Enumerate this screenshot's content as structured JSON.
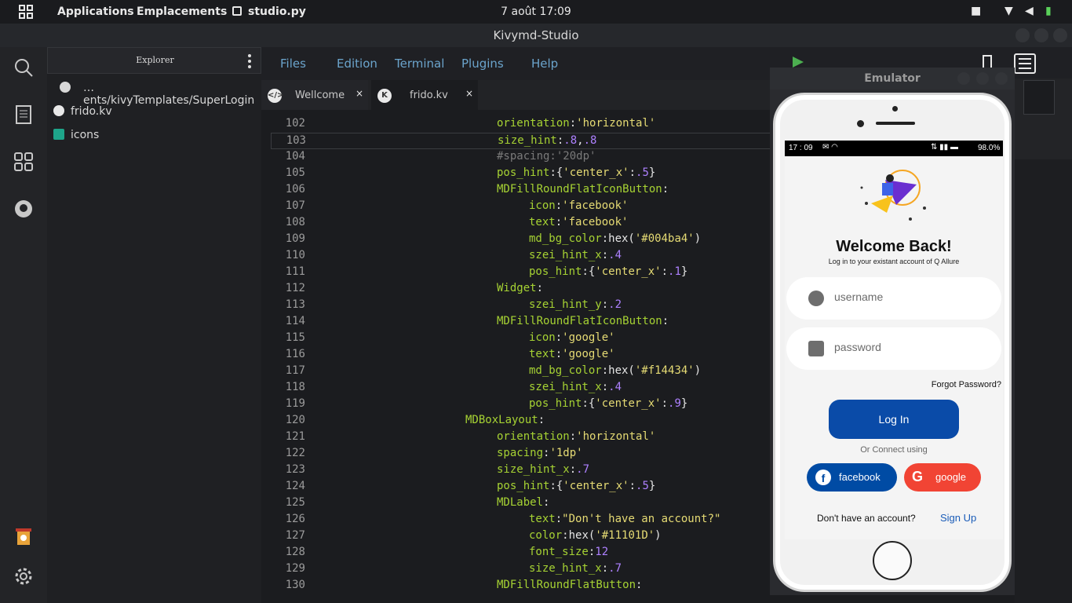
{
  "topbar": {
    "applications": "Applications",
    "emplacements": "Emplacements",
    "active_app": "studio.py",
    "clock": "7 août  17:09"
  },
  "window": {
    "title": "Kivymd-Studio"
  },
  "explorer": {
    "header": "Explorer",
    "path": "…ents/kivyTemplates/SuperLogin",
    "items": [
      {
        "label": "frido.kv",
        "icon": "kivy-file-icon"
      },
      {
        "label": "icons",
        "icon": "folder-icon"
      }
    ]
  },
  "menu": [
    "Files",
    "Edition",
    "Terminal",
    "Plugins",
    "Help"
  ],
  "tabs": [
    {
      "label": "Wellcome",
      "close": "×"
    },
    {
      "label": "frido.kv",
      "close": "×"
    }
  ],
  "code": [
    {
      "n": "102",
      "indent": 300,
      "parts": [
        [
          "k",
          "orientation"
        ],
        [
          "p",
          ":"
        ],
        [
          "s",
          "'horizontal'"
        ]
      ]
    },
    {
      "n": "103",
      "indent": 300,
      "active": true,
      "parts": [
        [
          "k",
          "size_hint"
        ],
        [
          "p",
          ":"
        ],
        [
          "n",
          ".8"
        ],
        [
          "p",
          ","
        ],
        [
          "n",
          ".8"
        ]
      ]
    },
    {
      "n": "104",
      "indent": 300,
      "parts": [
        [
          "c",
          "#spacing:'20dp'"
        ]
      ]
    },
    {
      "n": "105",
      "indent": 300,
      "parts": [
        [
          "k",
          "pos_hint"
        ],
        [
          "p",
          ":{"
        ],
        [
          "s",
          "'center_x'"
        ],
        [
          "p",
          ":"
        ],
        [
          "n",
          ".5"
        ],
        [
          "p",
          "}"
        ]
      ]
    },
    {
      "n": "106",
      "indent": 300,
      "parts": [
        [
          "k",
          "MDFillRoundFlatIconButton"
        ],
        [
          "p",
          ":"
        ]
      ]
    },
    {
      "n": "107",
      "indent": 341,
      "parts": [
        [
          "k",
          "icon"
        ],
        [
          "p",
          ":"
        ],
        [
          "s",
          "'facebook'"
        ]
      ]
    },
    {
      "n": "108",
      "indent": 341,
      "parts": [
        [
          "k",
          "text"
        ],
        [
          "p",
          ":"
        ],
        [
          "s",
          "'facebook'"
        ]
      ]
    },
    {
      "n": "109",
      "indent": 341,
      "parts": [
        [
          "k",
          "md_bg_color"
        ],
        [
          "p",
          ":hex("
        ],
        [
          "s",
          "'#004ba4'"
        ],
        [
          "p",
          ")"
        ]
      ]
    },
    {
      "n": "110",
      "indent": 341,
      "parts": [
        [
          "k",
          "szei_hint_x"
        ],
        [
          "p",
          ":"
        ],
        [
          "n",
          ".4"
        ]
      ]
    },
    {
      "n": "111",
      "indent": 341,
      "parts": [
        [
          "k",
          "pos_hint"
        ],
        [
          "p",
          ":{"
        ],
        [
          "s",
          "'center_x'"
        ],
        [
          "p",
          ":"
        ],
        [
          "n",
          ".1"
        ],
        [
          "p",
          "}"
        ]
      ]
    },
    {
      "n": "112",
      "indent": 300,
      "parts": [
        [
          "k",
          "Widget"
        ],
        [
          "p",
          ":"
        ]
      ]
    },
    {
      "n": "113",
      "indent": 341,
      "parts": [
        [
          "k",
          "szei_hint_y"
        ],
        [
          "p",
          ":"
        ],
        [
          "n",
          ".2"
        ]
      ]
    },
    {
      "n": "114",
      "indent": 300,
      "parts": [
        [
          "k",
          "MDFillRoundFlatIconButton"
        ],
        [
          "p",
          ":"
        ]
      ]
    },
    {
      "n": "115",
      "indent": 341,
      "parts": [
        [
          "k",
          "icon"
        ],
        [
          "p",
          ":"
        ],
        [
          "s",
          "'google'"
        ]
      ]
    },
    {
      "n": "116",
      "indent": 341,
      "parts": [
        [
          "k",
          "text"
        ],
        [
          "p",
          ":"
        ],
        [
          "s",
          "'google'"
        ]
      ]
    },
    {
      "n": "117",
      "indent": 341,
      "parts": [
        [
          "k",
          "md_bg_color"
        ],
        [
          "p",
          ":hex("
        ],
        [
          "s",
          "'#f14434'"
        ],
        [
          "p",
          ")"
        ]
      ]
    },
    {
      "n": "118",
      "indent": 341,
      "parts": [
        [
          "k",
          "szei_hint_x"
        ],
        [
          "p",
          ":"
        ],
        [
          "n",
          ".4"
        ]
      ]
    },
    {
      "n": "119",
      "indent": 341,
      "parts": [
        [
          "k",
          "pos_hint"
        ],
        [
          "p",
          ":{"
        ],
        [
          "s",
          "'center_x'"
        ],
        [
          "p",
          ":"
        ],
        [
          "n",
          ".9"
        ],
        [
          "p",
          "}"
        ]
      ]
    },
    {
      "n": "120",
      "indent": 260,
      "parts": [
        [
          "k",
          "MDBoxLayout"
        ],
        [
          "p",
          ":"
        ]
      ]
    },
    {
      "n": "121",
      "indent": 300,
      "parts": [
        [
          "k",
          "orientation"
        ],
        [
          "p",
          ":"
        ],
        [
          "s",
          "'horizontal'"
        ]
      ]
    },
    {
      "n": "122",
      "indent": 300,
      "parts": [
        [
          "k",
          "spacing"
        ],
        [
          "p",
          ":"
        ],
        [
          "s",
          "'1dp'"
        ]
      ]
    },
    {
      "n": "123",
      "indent": 300,
      "parts": [
        [
          "k",
          "size_hint_x"
        ],
        [
          "p",
          ":"
        ],
        [
          "n",
          ".7"
        ]
      ]
    },
    {
      "n": "124",
      "indent": 300,
      "parts": [
        [
          "k",
          "pos_hint"
        ],
        [
          "p",
          ":{"
        ],
        [
          "s",
          "'center_x'"
        ],
        [
          "p",
          ":"
        ],
        [
          "n",
          ".5"
        ],
        [
          "p",
          "}"
        ]
      ]
    },
    {
      "n": "125",
      "indent": 300,
      "parts": [
        [
          "k",
          "MDLabel"
        ],
        [
          "p",
          ":"
        ]
      ]
    },
    {
      "n": "126",
      "indent": 341,
      "parts": [
        [
          "k",
          "text"
        ],
        [
          "p",
          ":"
        ],
        [
          "s",
          "\"Don't have an account?\""
        ]
      ]
    },
    {
      "n": "127",
      "indent": 341,
      "parts": [
        [
          "k",
          "color"
        ],
        [
          "p",
          ":hex("
        ],
        [
          "s",
          "'#11101D'"
        ],
        [
          "p",
          ")"
        ]
      ]
    },
    {
      "n": "128",
      "indent": 341,
      "parts": [
        [
          "k",
          "font_size"
        ],
        [
          "p",
          ":"
        ],
        [
          "n",
          "12"
        ]
      ]
    },
    {
      "n": "129",
      "indent": 341,
      "parts": [
        [
          "k",
          "size_hint_x"
        ],
        [
          "p",
          ":"
        ],
        [
          "n",
          ".7"
        ]
      ]
    },
    {
      "n": "130",
      "indent": 300,
      "parts": [
        [
          "k",
          "MDFillRoundFlatButton"
        ],
        [
          "p",
          ":"
        ]
      ]
    }
  ],
  "emulator": {
    "title": "Emulator",
    "status": {
      "time": "17 : 09",
      "battery": "98.0%"
    },
    "welcome": "Welcome Back!",
    "subtitle": "Log in to your existant account of Q Allure",
    "username_placeholder": "username",
    "password_placeholder": "password",
    "forgot": "Forgot Password?",
    "login": "Log In",
    "or_connect": "Or Connect using",
    "facebook": "facebook",
    "google": "google",
    "no_account": "Don't have an account?",
    "signup": "Sign Up",
    "colors": {
      "facebook": "#004ba4",
      "google": "#f14434",
      "login": "#0a4ba8"
    }
  }
}
